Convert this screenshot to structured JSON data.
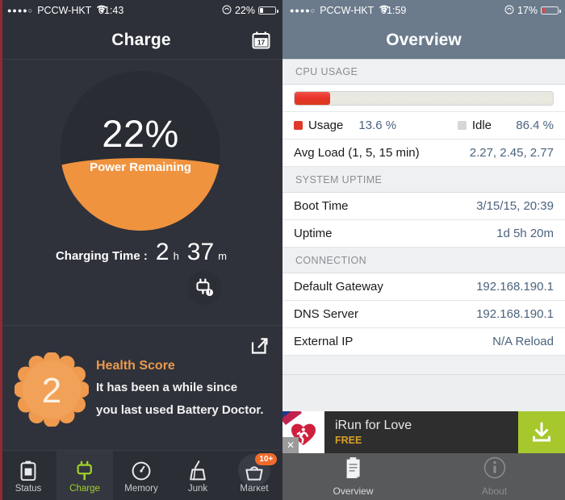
{
  "left": {
    "status_bar": {
      "signal_dots": "●●●●○",
      "carrier": "PCCW-HKT",
      "wifi_icon": "wifi-icon",
      "time": "01:43",
      "lock_icon": "rotation-lock-icon",
      "battery_percent": "22%",
      "battery_level": 22
    },
    "nav": {
      "title": "Charge",
      "calendar_icon": "calendar-icon",
      "calendar_day": "17"
    },
    "gauge": {
      "percent_label": "22%",
      "caption": "Power Remaining",
      "fill_level": 41,
      "plug_icon": "plug-alert-icon"
    },
    "charging_time": {
      "label": "Charging Time :",
      "hours": "2",
      "hours_unit": "h",
      "minutes": "37",
      "minutes_unit": "m"
    },
    "health": {
      "share_icon": "share-export-icon",
      "score": "2",
      "title": "Health Score",
      "line1": "It has been a while since",
      "line2": "you last used Battery Doctor."
    },
    "tabs": [
      {
        "label": "Status",
        "icon": "battery-icon",
        "active": false,
        "badge": ""
      },
      {
        "label": "Charge",
        "icon": "plug-icon",
        "active": true,
        "badge": ""
      },
      {
        "label": "Memory",
        "icon": "gauge-icon",
        "active": false,
        "badge": ""
      },
      {
        "label": "Junk",
        "icon": "broom-icon",
        "active": false,
        "badge": ""
      },
      {
        "label": "Market",
        "icon": "bag-icon",
        "active": false,
        "badge": "10+"
      }
    ],
    "colors": {
      "background": "#2f323a",
      "accent_orange": "#f0933f",
      "accent_green": "#a0d22a",
      "badge_orange": "#ef6b2c"
    }
  },
  "right": {
    "status_bar": {
      "signal_dots": "●●●●○",
      "carrier": "PCCW-HKT",
      "wifi_icon": "wifi-icon",
      "time": "01:59",
      "lock_icon": "rotation-lock-icon",
      "battery_percent": "17%",
      "battery_level": 17
    },
    "nav": {
      "title": "Overview"
    },
    "sections": [
      {
        "header": "CPU USAGE",
        "progress": {
          "value": 13.6,
          "max": 100,
          "color": "#e83228"
        },
        "legend": [
          {
            "name": "Usage",
            "value": "13.6 %",
            "swatch": "red"
          },
          {
            "name": "Idle",
            "value": "86.4 %",
            "swatch": "gray"
          }
        ],
        "rows": [
          {
            "key": "Avg Load (1, 5, 15 min)",
            "value": "2.27, 2.45, 2.77"
          }
        ]
      },
      {
        "header": "SYSTEM UPTIME",
        "rows": [
          {
            "key": "Boot Time",
            "value": "3/15/15, 20:39"
          },
          {
            "key": "Uptime",
            "value": "1d 5h 20m"
          }
        ]
      },
      {
        "header": "CONNECTION",
        "rows": [
          {
            "key": "Default Gateway",
            "value": "192.168.190.1"
          },
          {
            "key": "DNS Server",
            "value": "192.168.190.1"
          },
          {
            "key": "External IP",
            "value": "N/A Reload"
          }
        ]
      }
    ],
    "partial_section_header": "",
    "ad": {
      "close_icon": "close-icon",
      "app_icon": "heart-runner-icon",
      "title": "iRun for Love",
      "price": "FREE",
      "download_icon": "download-icon"
    },
    "tabs": [
      {
        "label": "Overview",
        "icon": "clipboard-icon",
        "active": true
      },
      {
        "label": "About",
        "icon": "info-icon",
        "active": false
      }
    ],
    "colors": {
      "nav_background": "#6b7b8c",
      "cpu_red": "#e83228",
      "value_blue": "#4b637d",
      "ad_green": "#a6c82c"
    }
  }
}
